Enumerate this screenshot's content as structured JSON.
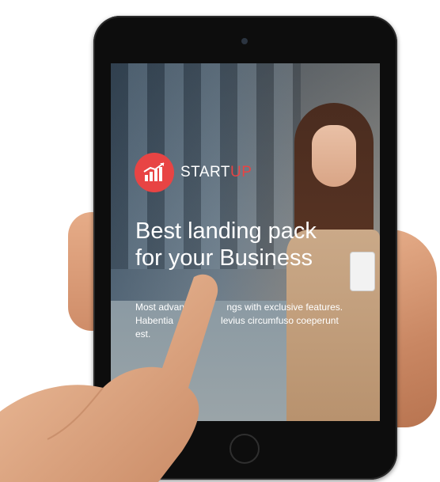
{
  "brand": {
    "name_main": "START",
    "name_accent": "UP",
    "accent_color": "#e84444"
  },
  "hero": {
    "headline_line1": "Best landing pack",
    "headline_line2": "for your Business",
    "description_line1": "Most advan                ngs with exclusive features.",
    "description_line2": "Habentia                  levius circumfuso coeperunt",
    "description_line3": "est."
  },
  "icons": {
    "logo": "rising-chart-icon"
  }
}
